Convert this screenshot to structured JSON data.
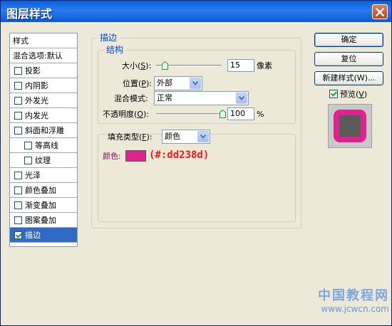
{
  "window": {
    "title": "图层样式"
  },
  "left_list": {
    "header": "样式",
    "blend_options": "混合选项:默认",
    "items": [
      {
        "label": "投影",
        "checked": false,
        "indent": false,
        "selected": false
      },
      {
        "label": "内阴影",
        "checked": false,
        "indent": false,
        "selected": false
      },
      {
        "label": "外发光",
        "checked": false,
        "indent": false,
        "selected": false
      },
      {
        "label": "内发光",
        "checked": false,
        "indent": false,
        "selected": false
      },
      {
        "label": "斜面和浮雕",
        "checked": false,
        "indent": false,
        "selected": false
      },
      {
        "label": "等高线",
        "checked": false,
        "indent": true,
        "selected": false
      },
      {
        "label": "纹理",
        "checked": false,
        "indent": true,
        "selected": false
      },
      {
        "label": "光泽",
        "checked": false,
        "indent": false,
        "selected": false
      },
      {
        "label": "颜色叠加",
        "checked": false,
        "indent": false,
        "selected": false
      },
      {
        "label": "渐变叠加",
        "checked": false,
        "indent": false,
        "selected": false
      },
      {
        "label": "图案叠加",
        "checked": false,
        "indent": false,
        "selected": false
      },
      {
        "label": "描边",
        "checked": true,
        "indent": false,
        "selected": true
      }
    ]
  },
  "stroke": {
    "group_title": "描边",
    "structure": {
      "group_title": "结构",
      "size_label": "大小",
      "size_key": "S",
      "size_value": "15",
      "size_unit": "像素",
      "position_label": "位置",
      "position_key": "P",
      "position_value": "外部",
      "blend_mode_label": "混合模式:",
      "blend_mode_value": "正常",
      "opacity_label": "不透明度",
      "opacity_key": "O",
      "opacity_value": "100",
      "opacity_unit": "%"
    },
    "fill": {
      "fill_type_label": "填充类型",
      "fill_type_key": "F",
      "fill_type_value": "颜色",
      "color_label": "颜色:",
      "color": "#dd238d",
      "color_annotation": "(#:dd238d)"
    }
  },
  "buttons": {
    "ok": "确定",
    "reset": "复位",
    "new_style": "新建样式(W)...",
    "preview_label": "预览",
    "preview_key": "V"
  },
  "watermark": {
    "line1": "中国教程网",
    "line2": "www.jcwcn.com"
  }
}
